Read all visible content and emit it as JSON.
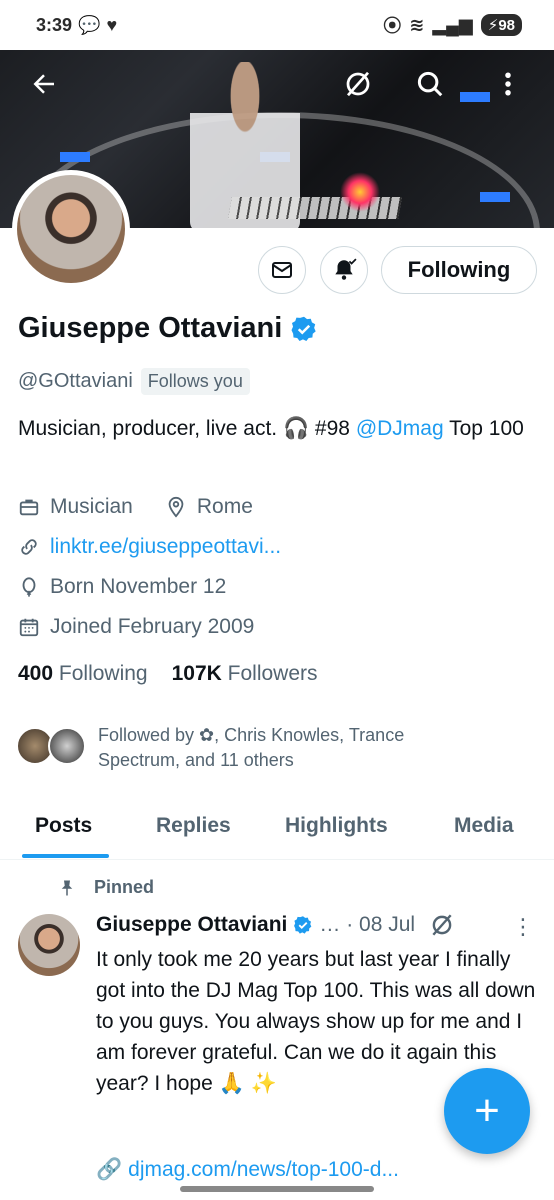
{
  "status_bar": {
    "time": "3:39",
    "battery": "98"
  },
  "profile": {
    "name": "Giuseppe Ottaviani",
    "handle": "@GOttaviani",
    "follows_you": "Follows you",
    "bio_text": "Musician, producer, live act. 🎧 #98 ",
    "bio_link": "@DJmag",
    "bio_tail": " Top 100",
    "category": "Musician",
    "location": "Rome",
    "website": "linktr.ee/giuseppeottavi...",
    "born": "Born November 12",
    "joined": "Joined February 2009",
    "following_count": "400",
    "following_label": "Following",
    "followers_count": "107K",
    "followers_label": "Followers",
    "followed_by": "Followed by ✿, Chris Knowles, Trance Spectrum, and 11 others"
  },
  "actions": {
    "following_button": "Following"
  },
  "tabs": [
    {
      "label": "Posts"
    },
    {
      "label": "Replies"
    },
    {
      "label": "Highlights"
    },
    {
      "label": "Media"
    }
  ],
  "pinned_post": {
    "pinned_label": "Pinned",
    "author": "Giuseppe Ottaviani",
    "meta": "… · 08 Jul",
    "text": "It only took me 20 years but last year I finally got into the DJ Mag Top 100. This was all down to you guys. You always show up for me and I am forever grateful. Can we do it again this year? I hope 🙏 ✨",
    "link": "djmag.com/news/top-100-d..."
  },
  "fab": {
    "label": "+"
  },
  "colors": {
    "accent": "#1d9bf0",
    "text": "#0f1419",
    "muted": "#536471"
  }
}
